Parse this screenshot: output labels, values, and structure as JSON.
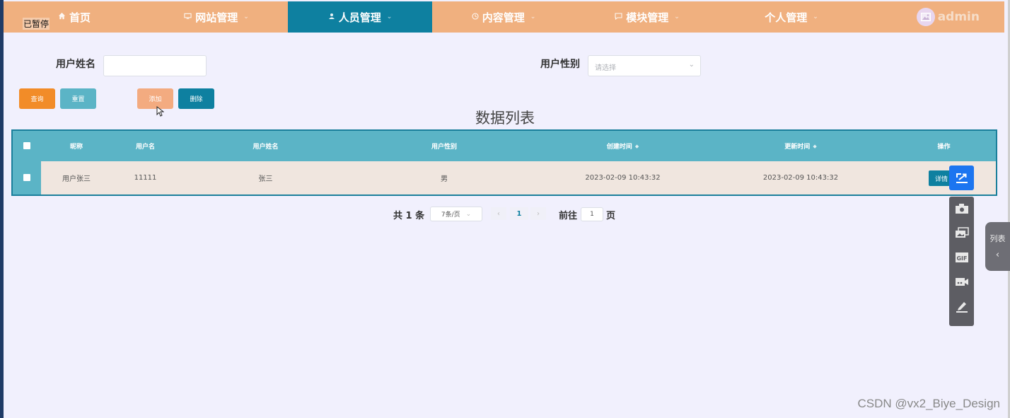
{
  "overlay": {
    "paused": "已暂停"
  },
  "nav": {
    "items": [
      {
        "label": "首页",
        "icon": "home-icon",
        "has_caret": false,
        "active": false
      },
      {
        "label": "网站管理",
        "icon": "monitor-icon",
        "has_caret": true,
        "active": false
      },
      {
        "label": "人员管理",
        "icon": "user-icon",
        "has_caret": true,
        "active": true
      },
      {
        "label": "内容管理",
        "icon": "clock-icon",
        "has_caret": true,
        "active": false
      },
      {
        "label": "模块管理",
        "icon": "chat-icon",
        "has_caret": true,
        "active": false
      },
      {
        "label": "个人管理",
        "icon": "",
        "has_caret": true,
        "active": false
      }
    ],
    "user": {
      "name": "admin",
      "avatar_icon": "image-icon"
    }
  },
  "search": {
    "name_label": "用户姓名",
    "name_value": "",
    "gender_label": "用户性别",
    "gender_placeholder": "请选择"
  },
  "actions": {
    "query": "查询",
    "reset": "重置",
    "add": "添加",
    "delete": "删除"
  },
  "list_title": "数据列表",
  "table": {
    "columns": [
      "昵称",
      "用户名",
      "用户姓名",
      "用户性别",
      "创建时间",
      "更新时间",
      "操作"
    ],
    "sortable": [
      false,
      false,
      false,
      false,
      true,
      true,
      false
    ],
    "rows": [
      {
        "nickname": "用户张三",
        "username": "11111",
        "realname": "张三",
        "gender": "男",
        "created": "2023-02-09 10:43:32",
        "updated": "2023-02-09 10:43:32",
        "action": "详情"
      }
    ]
  },
  "pagination": {
    "total": "共 1 条",
    "page_size": "7条/页",
    "current_page": "1",
    "goto_prefix": "前往",
    "goto_value": "1",
    "goto_suffix": "页"
  },
  "side_panel": {
    "label": "列表"
  },
  "watermark": "CSDN @vx2_Biye_Design",
  "colors": {
    "nav_bg": "#f0b07f",
    "nav_active": "#0e80a0",
    "page_bg": "#f1f0fd",
    "table_header": "#5bb4c6",
    "row_bg": "#f0e6df",
    "query_btn": "#f28c28",
    "reset_btn": "#5bb4c6",
    "add_btn": "#f3ab80",
    "delete_btn": "#0e80a0",
    "share_btn": "#1c75f0"
  }
}
